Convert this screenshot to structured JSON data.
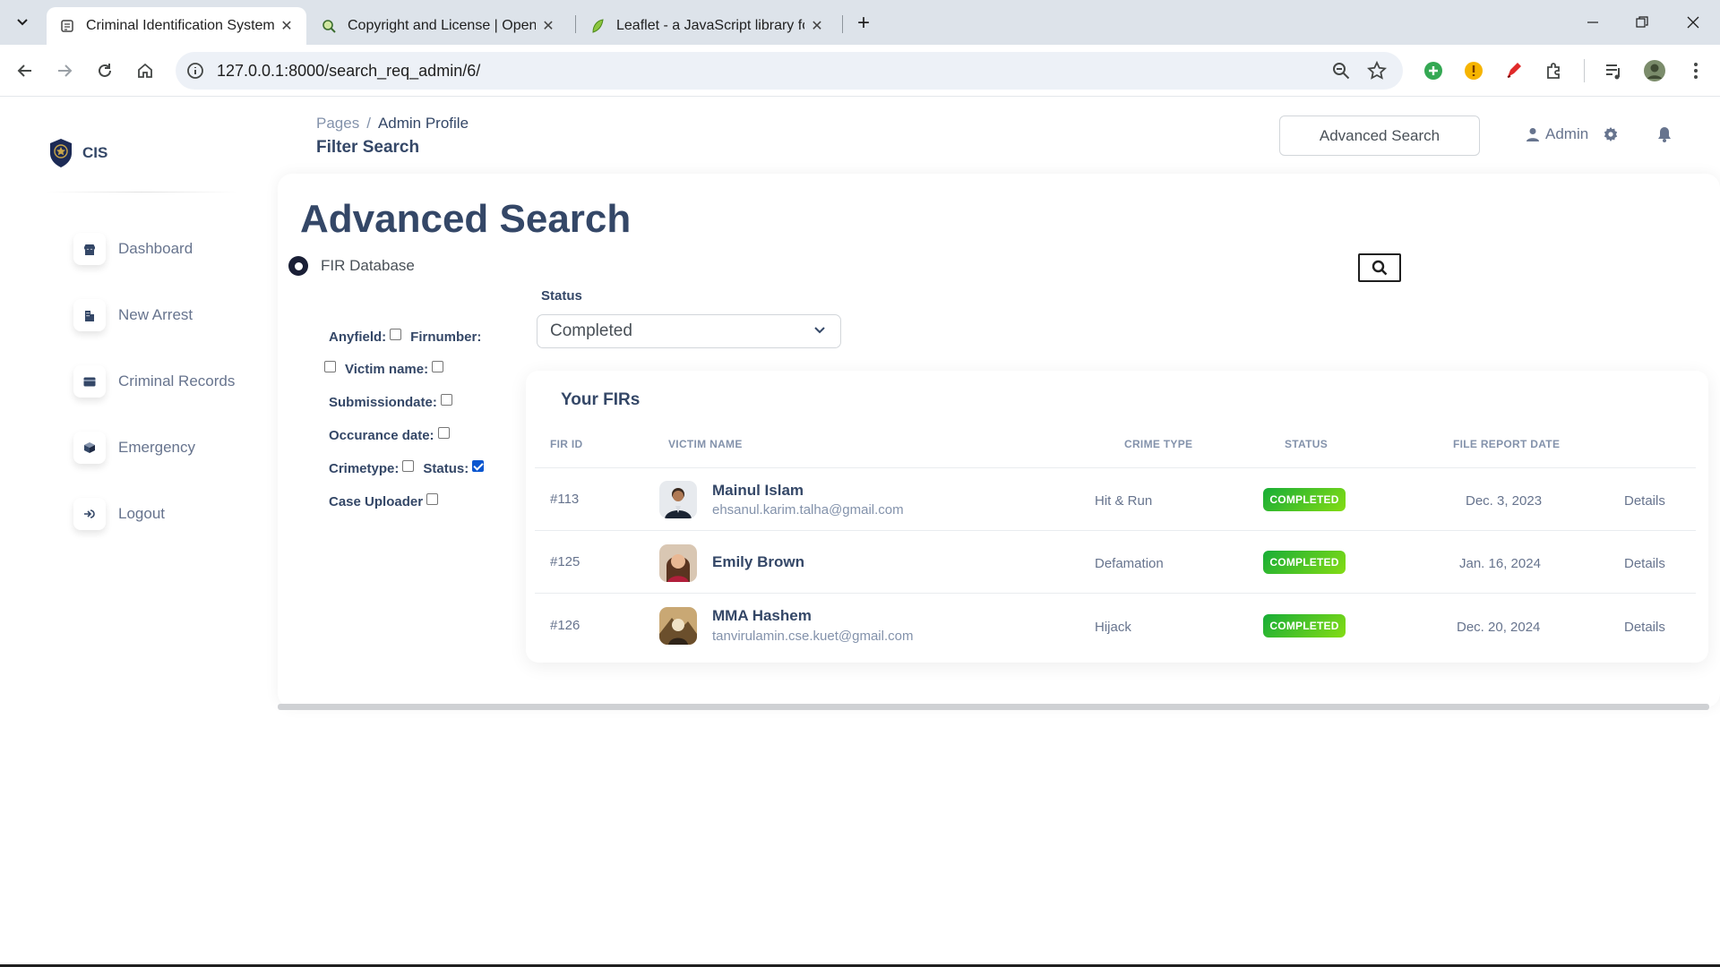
{
  "browser": {
    "tabs": [
      {
        "title": "Criminal Identification System -",
        "active": true
      },
      {
        "title": "Copyright and License | OpenSt",
        "active": false
      },
      {
        "title": "Leaflet - a JavaScript library for",
        "active": false
      }
    ],
    "url": "127.0.0.1:8000/search_req_admin/6/"
  },
  "sidebar": {
    "brand": "CIS",
    "items": [
      {
        "label": "Dashboard",
        "icon": "shop-icon"
      },
      {
        "label": "New Arrest",
        "icon": "office-icon"
      },
      {
        "label": "Criminal Records",
        "icon": "credit-card-icon"
      },
      {
        "label": "Emergency",
        "icon": "box-icon"
      },
      {
        "label": "Logout",
        "icon": "logout-icon"
      }
    ]
  },
  "header": {
    "breadcrumb": {
      "root": "Pages",
      "current": "Admin Profile"
    },
    "title": "Filter Search",
    "search_button": "Advanced Search",
    "user": "Admin"
  },
  "main": {
    "title": "Advanced Search",
    "database_option": "FIR Database",
    "filters": {
      "anyfield": "Anyfield:",
      "firnumber": "Firnumber:",
      "victim_name": "Victim name:",
      "submissiondate": "Submissiondate:",
      "occurance_date": "Occurance date:",
      "crimetype": "Crimetype:",
      "status": "Status:",
      "case_uploader": "Case Uploader"
    },
    "status_label": "Status",
    "status_selected": "Completed"
  },
  "firs": {
    "title": "Your FIRs",
    "columns": [
      "FIR ID",
      "VICTIM NAME",
      "CRIME TYPE",
      "STATUS",
      "FILE REPORT DATE"
    ],
    "rows": [
      {
        "id": "#113",
        "name": "Mainul Islam",
        "email": "ehsanul.karim.talha@gmail.com",
        "crime": "Hit & Run",
        "status": "COMPLETED",
        "date": "Dec. 3, 2023",
        "action": "Details"
      },
      {
        "id": "#125",
        "name": "Emily Brown",
        "email": "",
        "crime": "Defamation",
        "status": "COMPLETED",
        "date": "Jan. 16, 2024",
        "action": "Details"
      },
      {
        "id": "#126",
        "name": "MMA Hashem",
        "email": "tanvirulamin.cse.kuet@gmail.com",
        "crime": "Hijack",
        "status": "COMPLETED",
        "date": "Dec. 20, 2024",
        "action": "Details"
      }
    ]
  },
  "colors": {
    "text_primary": "#344767",
    "text_secondary": "#67748e",
    "badge_green": "#17ad37",
    "checkbox_checked": "#0b57d0"
  }
}
